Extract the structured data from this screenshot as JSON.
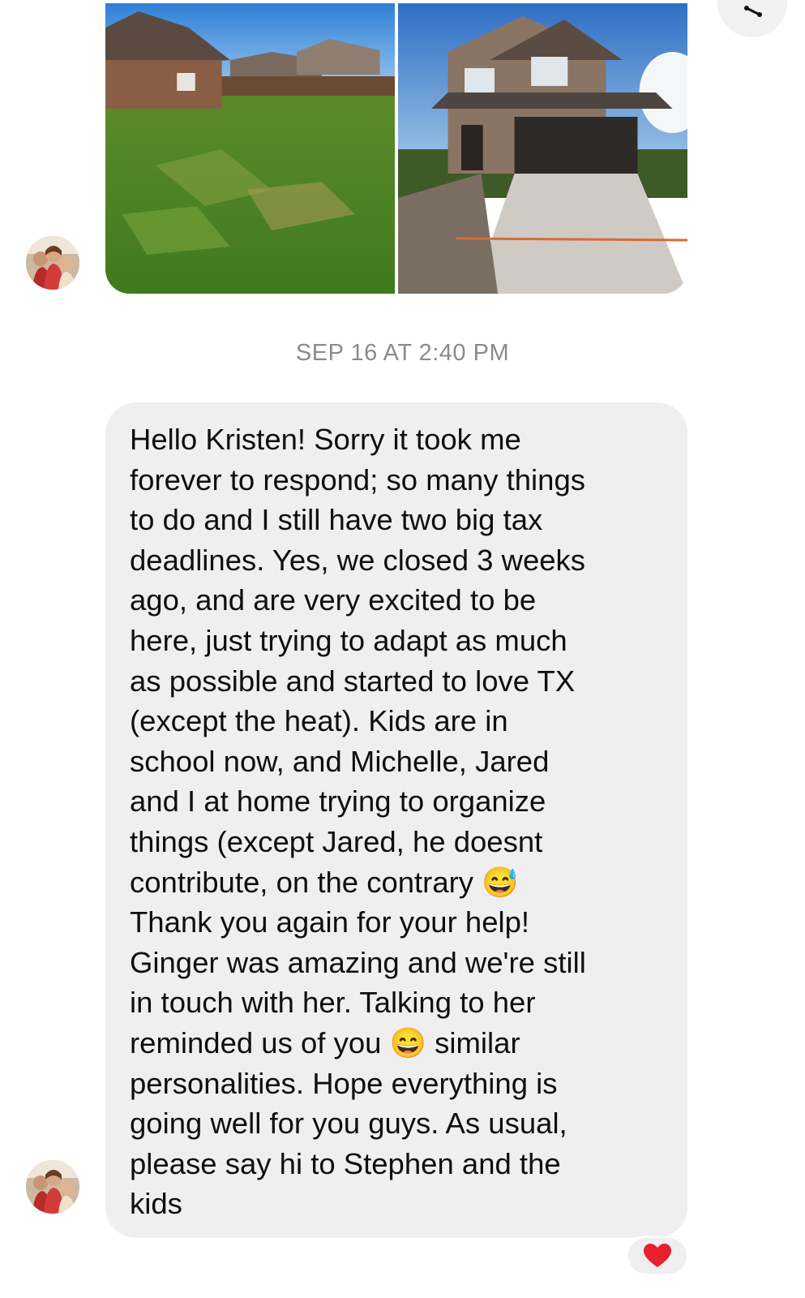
{
  "thread": {
    "share_icon": "share-icon",
    "photos": [
      {
        "icon": "backyard-lawn-photo"
      },
      {
        "icon": "house-front-photo"
      }
    ],
    "timestamp": "SEP 16 AT 2:40 PM",
    "message": {
      "lines": [
        "Hello Kristen! Sorry it took me",
        "forever to respond; so many things",
        "to do and I still have two big tax",
        "deadlines. Yes, we closed 3 weeks",
        "ago, and are very excited to be",
        "here, just trying to adapt as much",
        "as possible and started to love TX",
        "(except the heat). Kids are in",
        "school now, and Michelle, Jared",
        "and I at home trying to organize",
        "things (except Jared, he doesnt",
        "contribute, on the contrary 😅",
        "Thank you again for your help!",
        "Ginger was amazing and we're still",
        "in touch with her. Talking to her",
        "reminded us of you 😄 similar",
        "personalities. Hope everything is",
        "going well for you guys. As usual,",
        "please say hi to Stephen and the",
        "kids"
      ]
    },
    "reaction": {
      "icon": "heart-icon",
      "emoji": "❤️"
    },
    "sender_avatar": {
      "icon": "sender-avatar"
    },
    "colors": {
      "bubble": "#efefef",
      "timestamp": "#8b8b8b",
      "heart": "#e8202c"
    }
  }
}
